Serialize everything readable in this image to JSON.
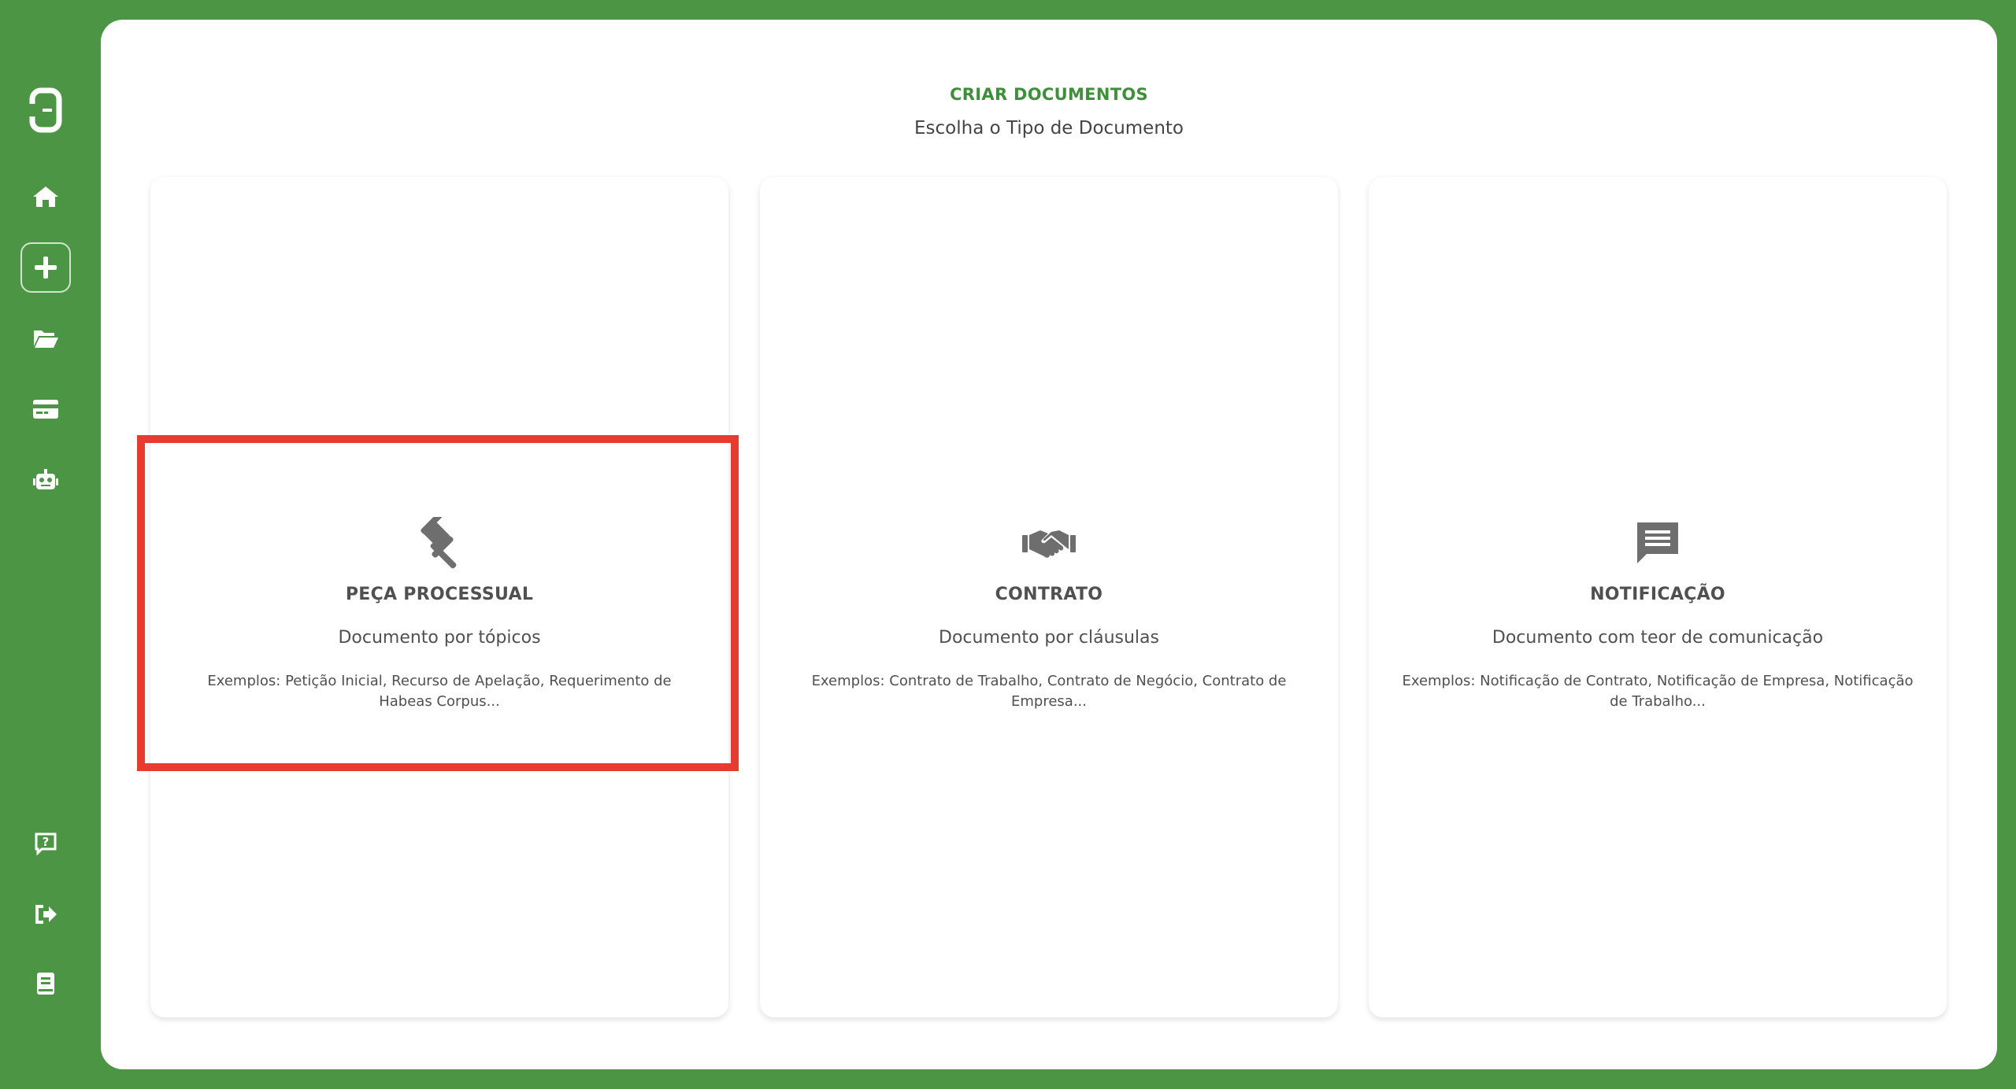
{
  "header": {
    "title": "CRIAR DOCUMENTOS",
    "subtitle": "Escolha o Tipo de Documento"
  },
  "sidebar": {
    "items": [
      {
        "icon": "app-logo-icon",
        "active": false
      },
      {
        "icon": "home-icon",
        "active": false
      },
      {
        "icon": "plus-icon",
        "active": true
      },
      {
        "icon": "folder-open-icon",
        "active": false
      },
      {
        "icon": "credit-card-icon",
        "active": false
      },
      {
        "icon": "robot-icon",
        "active": false
      },
      {
        "icon": "help-icon",
        "active": false
      },
      {
        "icon": "logout-icon",
        "active": false
      },
      {
        "icon": "book-icon",
        "active": false
      }
    ]
  },
  "cards": [
    {
      "icon": "gavel-icon",
      "title": "PEÇA PROCESSUAL",
      "description": "Documento por tópicos",
      "examples": "Exemplos: Petição Inicial, Recurso de Apelação, Requerimento de Habeas Corpus..."
    },
    {
      "icon": "handshake-icon",
      "title": "CONTRATO",
      "description": "Documento por cláusulas",
      "examples": "Exemplos: Contrato de Trabalho, Contrato de Negócio, Contrato de Empresa..."
    },
    {
      "icon": "message-icon",
      "title": "NOTIFICAÇÃO",
      "description": "Documento com teor de comunicação",
      "examples": "Exemplos: Notificação de Contrato, Notificação de Empresa, Notificação de Trabalho..."
    }
  ],
  "colors": {
    "brand_green": "#4c9544",
    "title_green": "#3f8f3a",
    "highlight_red": "#e63b2e",
    "icon_gray": "#6e6e6e"
  }
}
